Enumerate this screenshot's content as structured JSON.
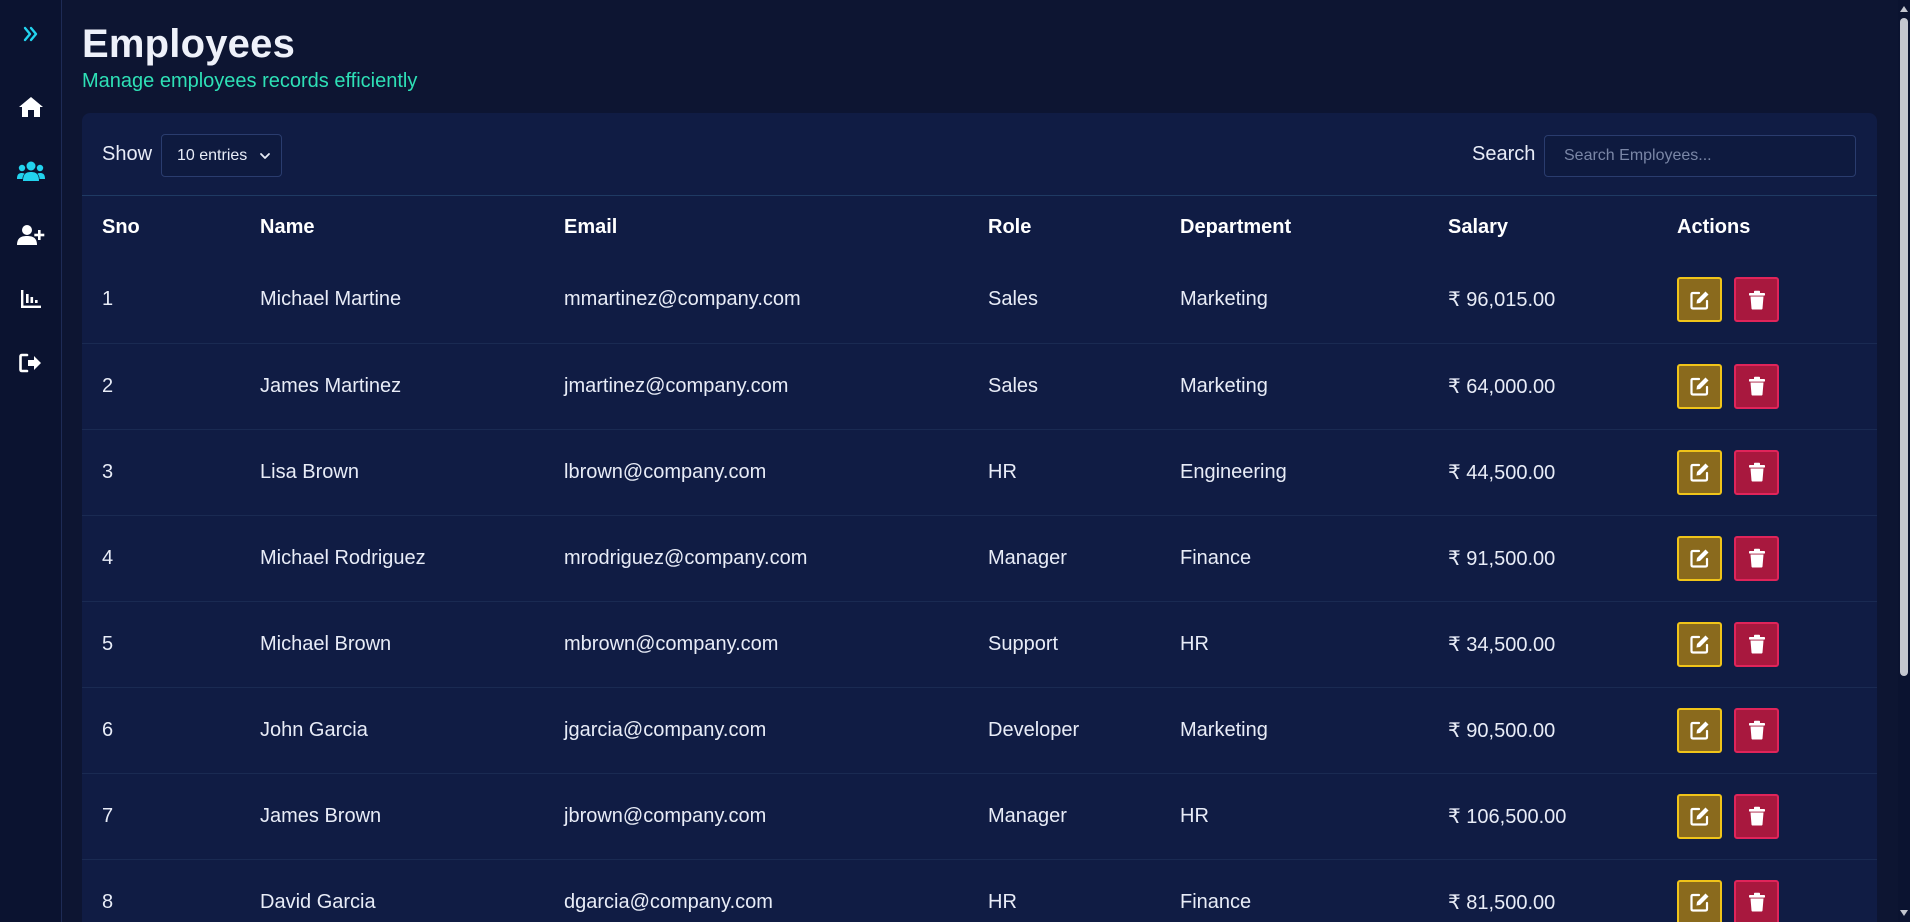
{
  "page": {
    "title": "Employees",
    "subtitle": "Manage employees records efficiently"
  },
  "sidebar": {
    "items": [
      {
        "name": "expand",
        "icon": "double-chevron-right-icon",
        "active": true
      },
      {
        "name": "home",
        "icon": "home-icon",
        "active": false
      },
      {
        "name": "employees",
        "icon": "users-icon",
        "active": true
      },
      {
        "name": "add-employee",
        "icon": "user-plus-icon",
        "active": false
      },
      {
        "name": "reports",
        "icon": "chart-bar-icon",
        "active": false
      },
      {
        "name": "logout",
        "icon": "sign-out-icon",
        "active": false
      }
    ]
  },
  "controls": {
    "show_label": "Show",
    "entries_value": "10 entries",
    "search_label": "Search",
    "search_placeholder": "Search Employees..."
  },
  "table": {
    "columns": [
      "Sno",
      "Name",
      "Email",
      "Role",
      "Department",
      "Salary",
      "Actions"
    ],
    "rows": [
      {
        "sno": "1",
        "name": "Michael Martine",
        "email": "mmartinez@company.com",
        "role": "Sales",
        "department": "Marketing",
        "salary": "₹ 96,015.00"
      },
      {
        "sno": "2",
        "name": "James Martinez",
        "email": "jmartinez@company.com",
        "role": "Sales",
        "department": "Marketing",
        "salary": "₹ 64,000.00"
      },
      {
        "sno": "3",
        "name": "Lisa Brown",
        "email": "lbrown@company.com",
        "role": "HR",
        "department": "Engineering",
        "salary": "₹ 44,500.00"
      },
      {
        "sno": "4",
        "name": "Michael Rodriguez",
        "email": "mrodriguez@company.com",
        "role": "Manager",
        "department": "Finance",
        "salary": "₹ 91,500.00"
      },
      {
        "sno": "5",
        "name": "Michael Brown",
        "email": "mbrown@company.com",
        "role": "Support",
        "department": "HR",
        "salary": "₹ 34,500.00"
      },
      {
        "sno": "6",
        "name": "John Garcia",
        "email": "jgarcia@company.com",
        "role": "Developer",
        "department": "Marketing",
        "salary": "₹ 90,500.00"
      },
      {
        "sno": "7",
        "name": "James Brown",
        "email": "jbrown@company.com",
        "role": "Manager",
        "department": "HR",
        "salary": "₹ 106,500.00"
      },
      {
        "sno": "8",
        "name": "David Garcia",
        "email": "dgarcia@company.com",
        "role": "HR",
        "department": "Finance",
        "salary": "₹ 81,500.00"
      }
    ],
    "action_icons": {
      "edit": "edit-icon",
      "delete": "trash-icon"
    }
  },
  "colors": {
    "background": "#0d1532",
    "card": "#101c44",
    "accent": "#22d3ee",
    "subtitle": "#2ee0b6",
    "edit_border": "#f0c419",
    "delete_bg": "#a8183e"
  }
}
